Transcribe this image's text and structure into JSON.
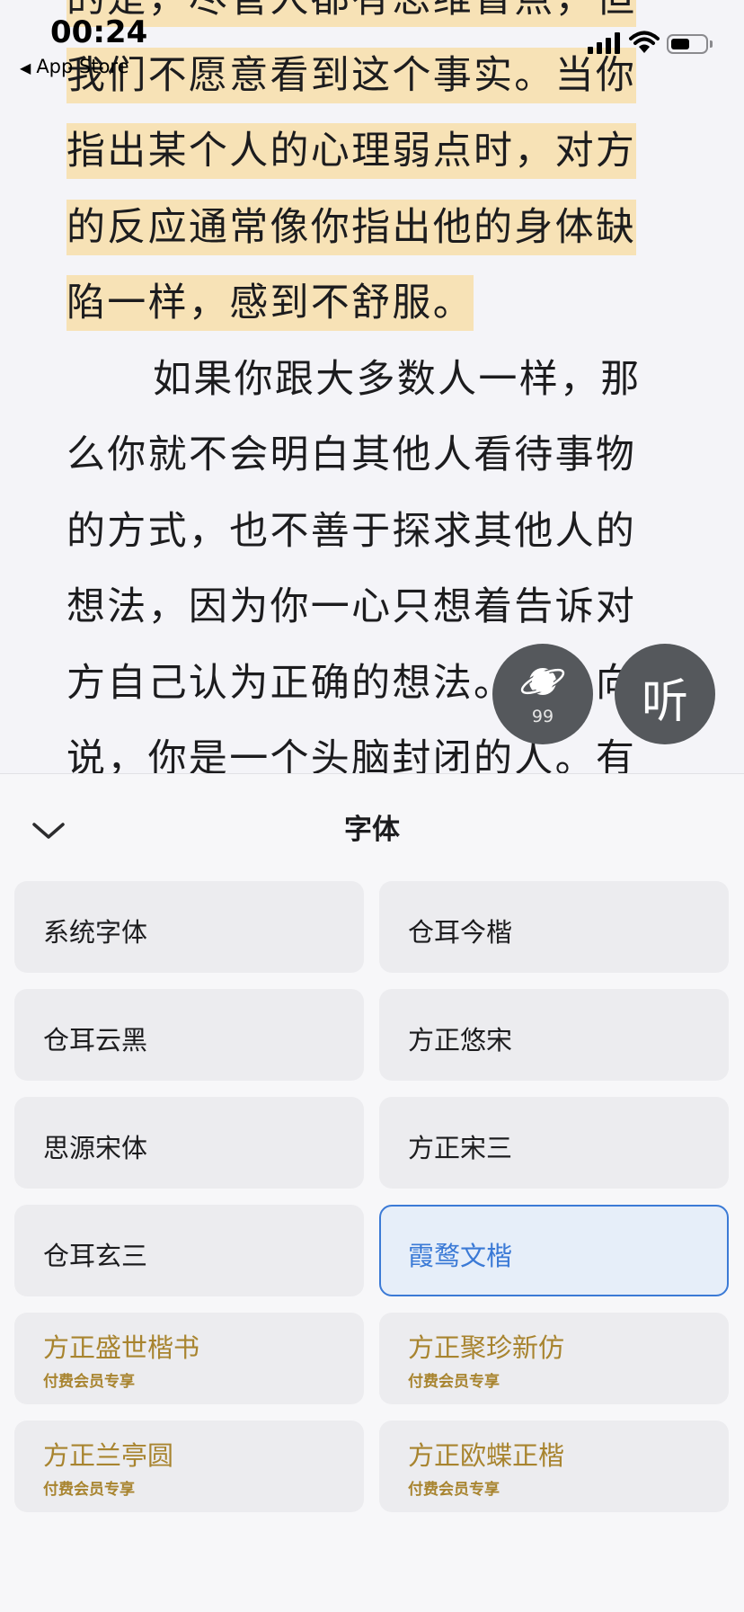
{
  "status_bar": {
    "time": "00:24",
    "back_app": "App Store"
  },
  "reader": {
    "lines": [
      {
        "text": "的是，尽管人都有思维盲点，但",
        "highlight": true
      },
      {
        "text": "我们不愿意看到这个事实。当你",
        "highlight": true
      },
      {
        "text": "指出某个人的心理弱点时，对方",
        "highlight": true
      },
      {
        "text": "的反应通常像你指出他的身体缺",
        "highlight": true
      },
      {
        "text": "陷一样，感到不舒服。",
        "highlight": true
      },
      {
        "text": "如果你跟大多数人一样，那",
        "highlight": false,
        "indent": true
      },
      {
        "text": "么你就不会明白其他人看待事物",
        "highlight": false
      },
      {
        "text": "的方式，也不善于探求其他人的",
        "highlight": false
      },
      {
        "text": "想法，因为你一心只想着告诉对",
        "highlight": false
      },
      {
        "text": "方自己认为正确的想法。有人向",
        "highlight": false
      },
      {
        "text": "说，你是一个头脑封闭的人。有",
        "highlight": false
      }
    ],
    "highlight_color": "#f7e2b6"
  },
  "floating": {
    "planet_count": "99",
    "listen_label": "听"
  },
  "panel": {
    "title": "字体",
    "fonts": [
      {
        "name": "系统字体",
        "selected": false
      },
      {
        "name": "仓耳今楷",
        "selected": false
      },
      {
        "name": "仓耳云黑",
        "selected": false
      },
      {
        "name": "方正悠宋",
        "selected": false
      },
      {
        "name": "思源宋体",
        "selected": false
      },
      {
        "name": "方正宋三",
        "selected": false
      },
      {
        "name": "仓耳玄三",
        "selected": false
      },
      {
        "name": "霞鹜文楷",
        "selected": true
      },
      {
        "name": "方正盛世楷书",
        "sub": "付费会员专享"
      },
      {
        "name": "方正聚珍新仿",
        "sub": "付费会员专享"
      },
      {
        "name": "方正兰亭圆",
        "sub": "付费会员专享"
      },
      {
        "name": "方正欧蝶正楷",
        "sub": "付费会员专享"
      }
    ],
    "accent_color": "#3b7ad6",
    "premium_color": "#a8842f"
  }
}
